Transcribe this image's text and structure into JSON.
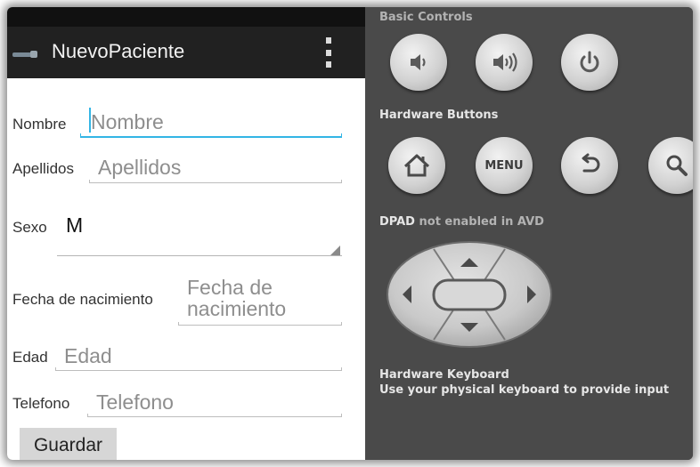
{
  "app": {
    "title": "NuevoPaciente"
  },
  "form": {
    "nombre": {
      "label": "Nombre",
      "placeholder": "Nombre"
    },
    "apellidos": {
      "label": "Apellidos",
      "placeholder": "Apellidos"
    },
    "sexo": {
      "label": "Sexo",
      "value": "M"
    },
    "fecha": {
      "label": "Fecha de nacimiento",
      "placeholder_line1": "Fecha de",
      "placeholder_line2": "nacimiento"
    },
    "edad": {
      "label": "Edad",
      "placeholder": "Edad"
    },
    "telefono": {
      "label": "Telefono",
      "placeholder": "Telefono"
    },
    "submit_label": "Guardar"
  },
  "controls": {
    "basic_title": "Basic Controls",
    "hardware_title": "Hardware Buttons",
    "menu_label": "MENU",
    "dpad_prefix": "DPAD",
    "dpad_suffix": " not enabled in AVD",
    "keyboard_title": "Hardware Keyboard",
    "keyboard_desc": "Use your physical keyboard to provide input"
  },
  "icons": {
    "basic": [
      "volume-down-icon",
      "volume-up-icon",
      "power-icon"
    ],
    "hardware": [
      "home-icon",
      "menu-icon",
      "back-icon",
      "search-icon"
    ]
  },
  "colors": {
    "action_bar": "#212121",
    "focus_underline": "#33b5e5",
    "panel": "#4a4a4a"
  }
}
